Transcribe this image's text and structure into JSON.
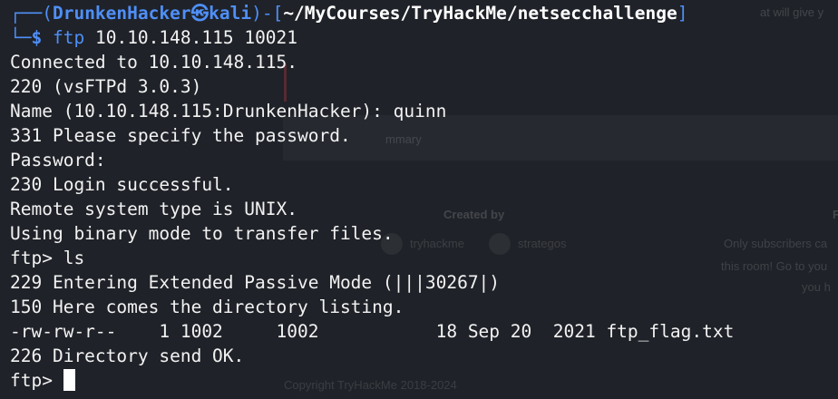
{
  "background_page": {
    "top_right_text": "at will give y",
    "panel_text": "mmary",
    "created_by_label": "Created by",
    "creators": [
      "tryhackme",
      "strategos"
    ],
    "right_heading_fragment": "F",
    "subscriber_notice": [
      "Only subscribers ca",
      "this room! Go to you",
      "you h"
    ],
    "copyright": "Copyright TryHackMe 2018-2024"
  },
  "terminal": {
    "prompt": {
      "open_bracket": "┌──(",
      "user": "DrunkenHacker",
      "at_symbol": "㉿",
      "host": "kali",
      "separator": ")-[",
      "path": "~/MyCourses/TryHackMe/netsecchallenge",
      "close_bracket": "]",
      "second_line_prefix": "└─",
      "dollar": "$",
      "command": "ftp",
      "args": "10.10.148.115 10021"
    },
    "output": [
      "Connected to 10.10.148.115.",
      "220 (vsFTPd 3.0.3)",
      "Name (10.10.148.115:DrunkenHacker): quinn",
      "331 Please specify the password.",
      "Password:",
      "230 Login successful.",
      "Remote system type is UNIX.",
      "Using binary mode to transfer files.",
      "ftp> ls",
      "229 Entering Extended Passive Mode (|||30267|)",
      "150 Here comes the directory listing.",
      "-rw-rw-r--    1 1002     1002           18 Sep 20  2021 ftp_flag.txt",
      "226 Directory send OK."
    ],
    "final_prompt": "ftp> "
  },
  "colors": {
    "background": "#1f2228",
    "prompt_blue": "#4f8ff7",
    "text": "#f2f2f2"
  }
}
